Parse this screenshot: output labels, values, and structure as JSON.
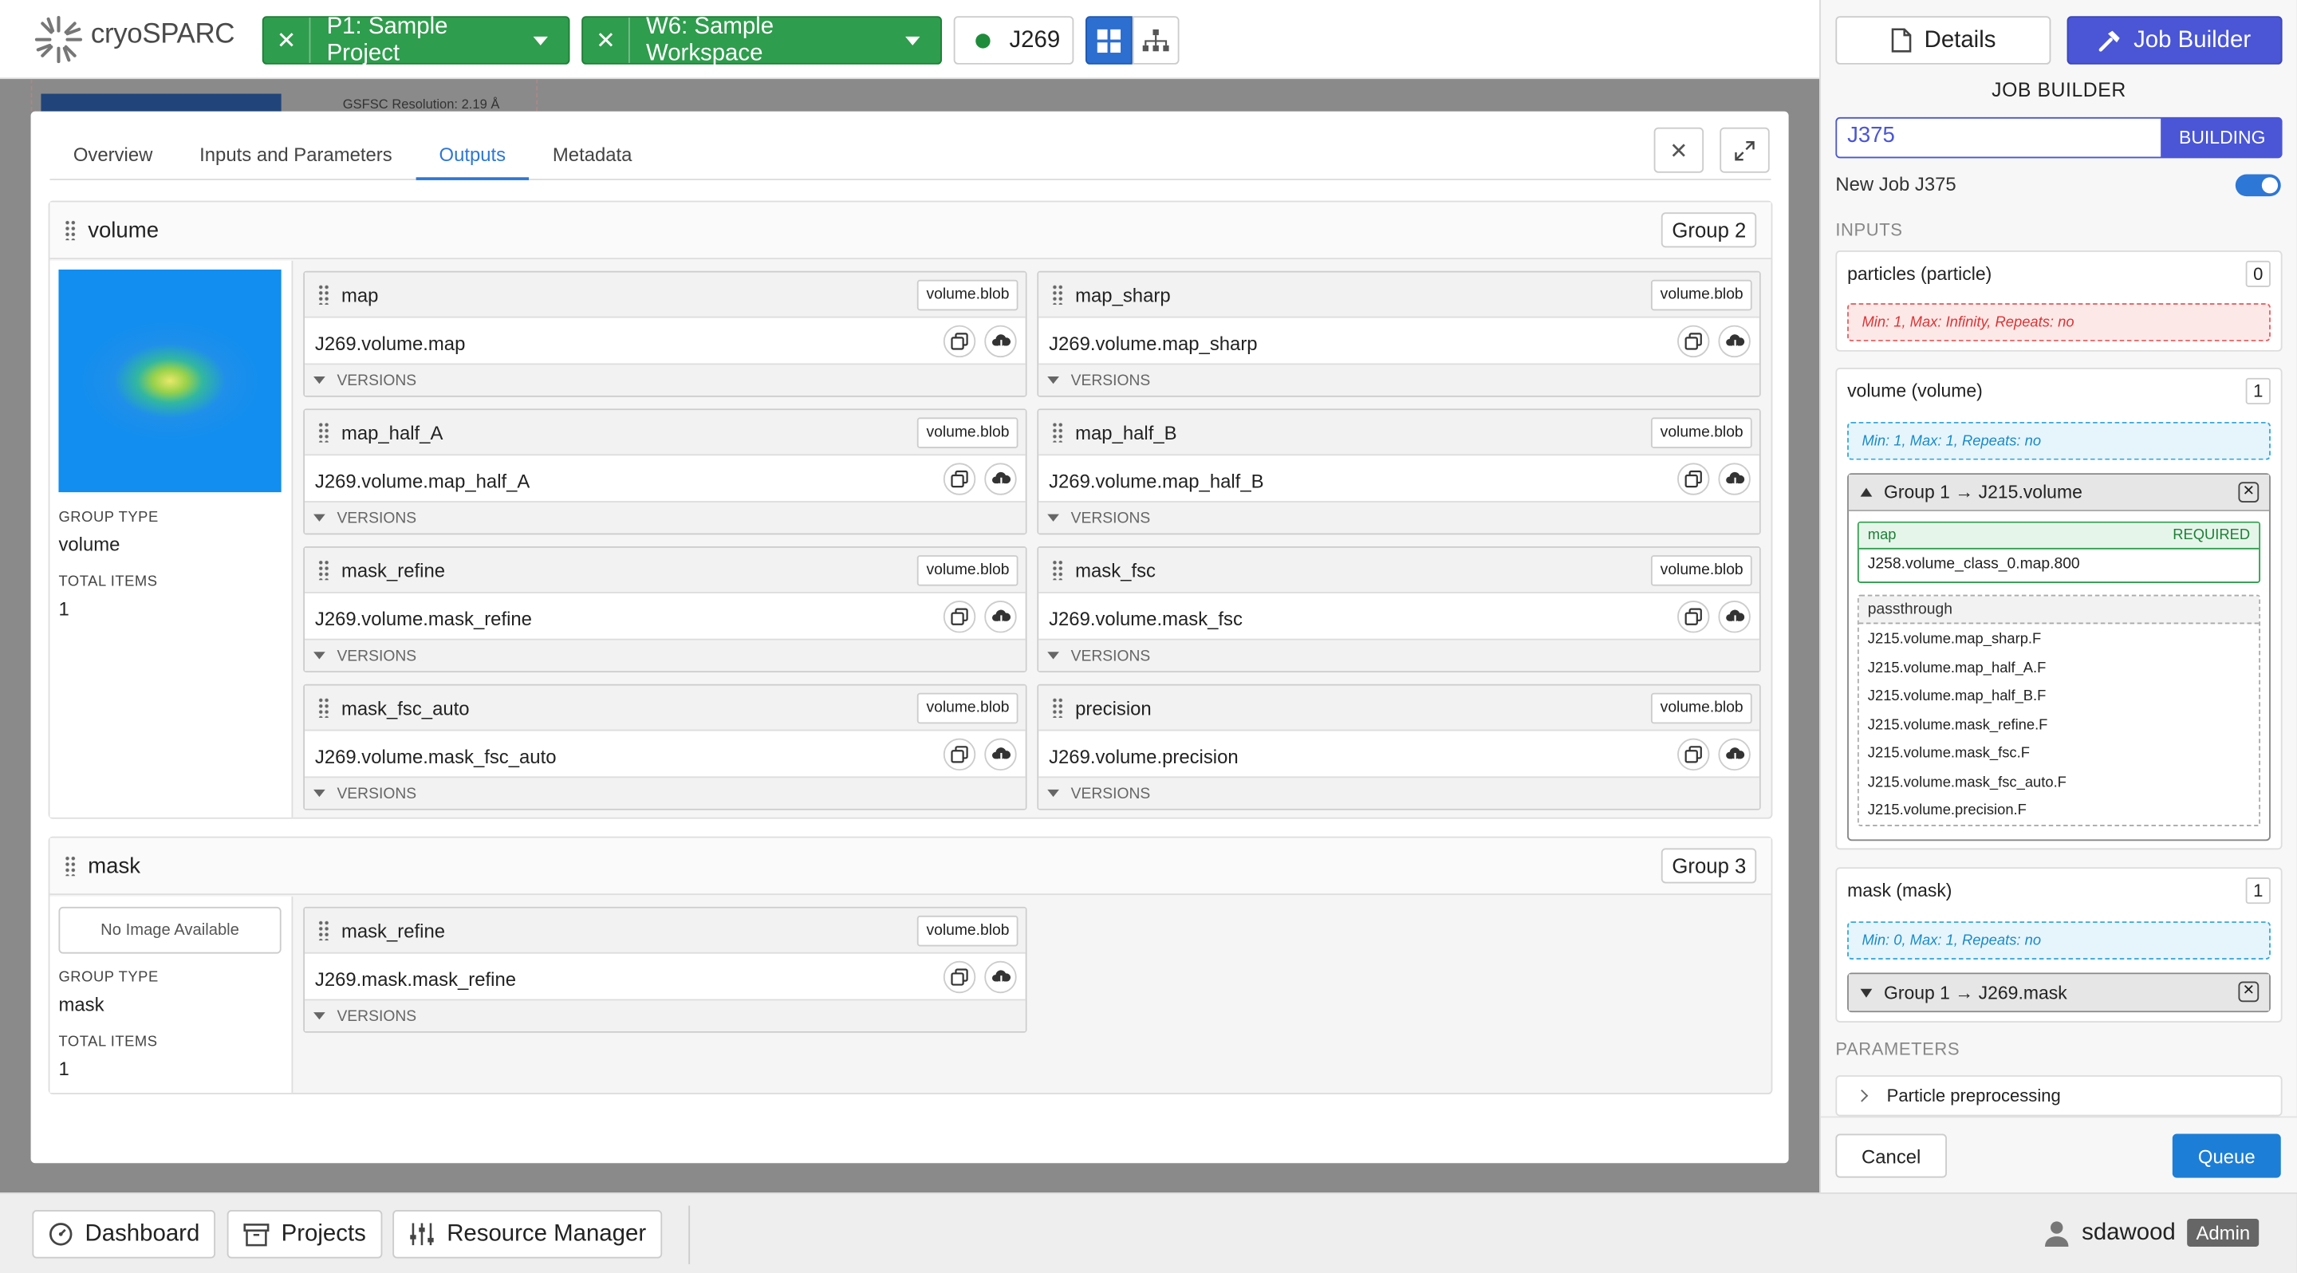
{
  "app": {
    "name": "cryoSPARC"
  },
  "header": {
    "project": "P1: Sample Project",
    "workspace": "W6: Sample Workspace",
    "job": "J269"
  },
  "background": {
    "resolution_text": "GSFSC Resolution: 2.19 Å"
  },
  "modal": {
    "tabs": [
      "Overview",
      "Inputs and Parameters",
      "Outputs",
      "Metadata"
    ],
    "active_tab": "Outputs",
    "groups": [
      {
        "name": "volume",
        "badge": "Group 2",
        "group_type_label": "GROUP TYPE",
        "group_type": "volume",
        "total_items_label": "TOTAL ITEMS",
        "total_items": "1",
        "outputs": [
          {
            "name": "map",
            "type": "volume.blob",
            "value": "J269.volume.map",
            "versions": "VERSIONS"
          },
          {
            "name": "map_sharp",
            "type": "volume.blob",
            "value": "J269.volume.map_sharp",
            "versions": "VERSIONS"
          },
          {
            "name": "map_half_A",
            "type": "volume.blob",
            "value": "J269.volume.map_half_A",
            "versions": "VERSIONS"
          },
          {
            "name": "map_half_B",
            "type": "volume.blob",
            "value": "J269.volume.map_half_B",
            "versions": "VERSIONS"
          },
          {
            "name": "mask_refine",
            "type": "volume.blob",
            "value": "J269.volume.mask_refine",
            "versions": "VERSIONS"
          },
          {
            "name": "mask_fsc",
            "type": "volume.blob",
            "value": "J269.volume.mask_fsc",
            "versions": "VERSIONS"
          },
          {
            "name": "mask_fsc_auto",
            "type": "volume.blob",
            "value": "J269.volume.mask_fsc_auto",
            "versions": "VERSIONS"
          },
          {
            "name": "precision",
            "type": "volume.blob",
            "value": "J269.volume.precision",
            "versions": "VERSIONS"
          }
        ]
      },
      {
        "name": "mask",
        "badge": "Group 3",
        "no_image": "No Image Available",
        "group_type_label": "GROUP TYPE",
        "group_type": "mask",
        "total_items_label": "TOTAL ITEMS",
        "total_items": "1",
        "outputs": [
          {
            "name": "mask_refine",
            "type": "volume.blob",
            "value": "J269.mask.mask_refine",
            "versions": "VERSIONS"
          }
        ]
      }
    ]
  },
  "bottombar": {
    "dashboard": "Dashboard",
    "projects": "Projects",
    "resource_manager": "Resource Manager",
    "username": "sdawood",
    "role": "Admin"
  },
  "right_panel": {
    "details_label": "Details",
    "job_builder_label": "Job Builder",
    "title": "JOB BUILDER",
    "job_id": "J375",
    "status": "BUILDING",
    "new_job_label": "New Job J375",
    "inputs_label": "INPUTS",
    "inputs": [
      {
        "name": "particles (particle)",
        "count": "0",
        "rule": "Min: 1, Max: Infinity, Repeats: no"
      },
      {
        "name": "volume (volume)",
        "count": "1",
        "rule": "Min: 1, Max: 1, Repeats: no",
        "connection": {
          "title": "Group 1 → J215.volume",
          "required_name": "map",
          "required_label": "REQUIRED",
          "required_value": "J258.volume_class_0.map.800",
          "passthrough_label": "passthrough",
          "passthrough": [
            "J215.volume.map_sharp.F",
            "J215.volume.map_half_A.F",
            "J215.volume.map_half_B.F",
            "J215.volume.mask_refine.F",
            "J215.volume.mask_fsc.F",
            "J215.volume.mask_fsc_auto.F",
            "J215.volume.precision.F"
          ]
        }
      },
      {
        "name": "mask (mask)",
        "count": "1",
        "rule": "Min: 0, Max: 1, Repeats: no",
        "connection": {
          "title": "Group 1 → J269.mask"
        }
      }
    ],
    "parameters_label": "PARAMETERS",
    "param_section": "Particle preprocessing",
    "cancel": "Cancel",
    "queue": "Queue"
  },
  "colors": {
    "green": "#2e9d4d",
    "accent": "#4a56d6",
    "blue": "#1c7ed6"
  }
}
